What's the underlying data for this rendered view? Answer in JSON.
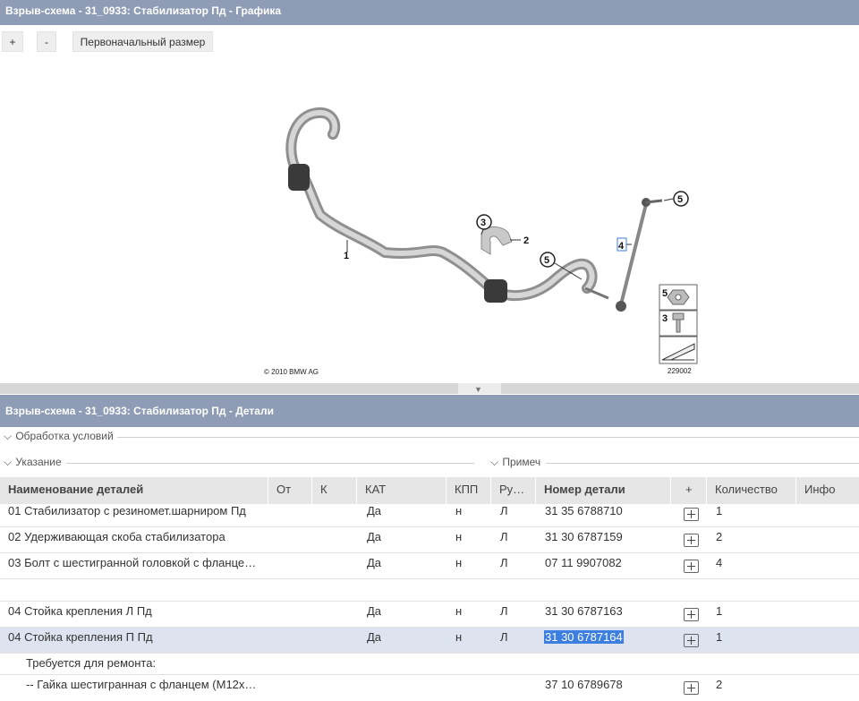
{
  "top_title": "Взрыв-схема - 31_0933: Стабилизатор Пд - Графика",
  "toolbar": {
    "zoom_in": "+",
    "zoom_out": "-",
    "reset": "Первоначальный размер"
  },
  "graphic": {
    "callouts": {
      "c1": "1",
      "c2": "2",
      "c3": "3",
      "c4": "4",
      "c5a": "5",
      "c5b": "5"
    },
    "legend": {
      "l5": "5",
      "l3": "3"
    },
    "copyright": "© 2010 BMW AG",
    "drawing_number": "229002"
  },
  "details_title": "Взрыв-схема - 31_0933: Стабилизатор Пд - Детали",
  "sections": {
    "conditions": "Обработка условий",
    "hint": "Указание",
    "note": "Примеч"
  },
  "table": {
    "headers": {
      "name": "Наименование деталей",
      "from": "От",
      "k": "К",
      "kat": "КАТ",
      "kpp": "КПП",
      "ru": "Ру…",
      "part": "Номер детали",
      "plus": "+",
      "qty": "Количество",
      "info": "Инфо"
    },
    "rows": [
      {
        "name": "01 Стабилизатор с резиномет.шарниром Пд",
        "kat": "Да",
        "kpp": "н",
        "ru": "Л",
        "part": "31 35 6788710",
        "qty": "1"
      },
      {
        "name": "02 Удерживающая скоба стабилизатора",
        "kat": "Да",
        "kpp": "н",
        "ru": "Л",
        "part": "31 30 6787159",
        "qty": "2"
      },
      {
        "name": "03 Болт с шестигранной головкой с фланце…",
        "kat": "Да",
        "kpp": "н",
        "ru": "Л",
        "part": "07 11 9907082",
        "qty": "4"
      },
      {
        "name": "04 Стойка крепления Л Пд",
        "kat": "Да",
        "kpp": "н",
        "ru": "Л",
        "part": "31 30 6787163",
        "qty": "1"
      },
      {
        "name": "04 Стойка крепления П Пд",
        "kat": "Да",
        "kpp": "н",
        "ru": "Л",
        "part": "31 30 6787164",
        "qty": "1"
      }
    ],
    "repair_label": "Требуется для ремонта:",
    "sub_row": {
      "name": "-- Гайка шестигранная с фланцем (M12x…",
      "part": "37 10 6789678",
      "qty": "2"
    }
  }
}
